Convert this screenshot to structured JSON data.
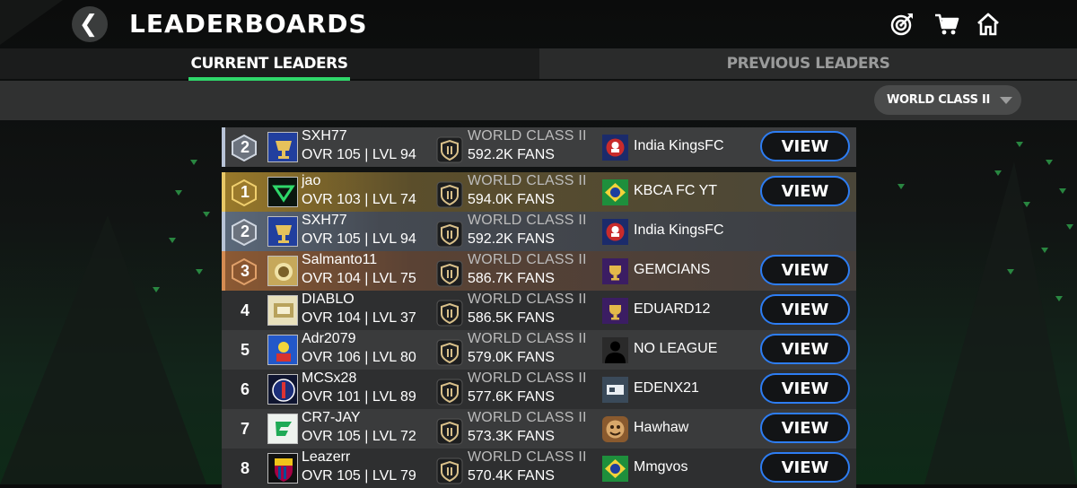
{
  "header": {
    "title": "LEADERBOARDS",
    "back_glyph": "❮",
    "icons": [
      "objectives-icon",
      "store-cart-icon",
      "home-icon"
    ]
  },
  "tabs": [
    {
      "label": "CURRENT LEADERS",
      "active": true
    },
    {
      "label": "PREVIOUS LEADERS",
      "active": false
    }
  ],
  "filter": {
    "selected": "WORLD CLASS II"
  },
  "view_label": "VIEW",
  "colors": {
    "accent_green": "#2fd86a",
    "view_border": "#2d7df3",
    "gold": "#c9a24a",
    "silver": "#9aa6b8",
    "bronze": "#b0744a"
  },
  "my_entry": {
    "rank": "2",
    "name": "SXH77",
    "stats": "OVR 105 | LVL 94",
    "division": "WORLD CLASS II",
    "fans": "592.2K FANS",
    "league": "India KingsFC",
    "has_view": true
  },
  "rows": [
    {
      "rank": "1",
      "name": "jao",
      "stats": "OVR 103 | LVL 74",
      "division": "WORLD CLASS II",
      "fans": "594.0K FANS",
      "league": "KBCA FC YT",
      "has_view": true
    },
    {
      "rank": "2",
      "name": "SXH77",
      "stats": "OVR 105 | LVL 94",
      "division": "WORLD CLASS II",
      "fans": "592.2K FANS",
      "league": "India KingsFC",
      "has_view": false
    },
    {
      "rank": "3",
      "name": "Salmanto11",
      "stats": "OVR 104 | LVL 75",
      "division": "WORLD CLASS II",
      "fans": "586.7K FANS",
      "league": "GEMCIANS",
      "has_view": true
    },
    {
      "rank": "4",
      "name": "DIABLO",
      "stats": "OVR 104 | LVL 37",
      "division": "WORLD CLASS II",
      "fans": "586.5K FANS",
      "league": "EDUARD12",
      "has_view": true
    },
    {
      "rank": "5",
      "name": "Adr2079",
      "stats": "OVR 106 | LVL 80",
      "division": "WORLD CLASS II",
      "fans": "579.0K FANS",
      "league": "NO LEAGUE",
      "has_view": true
    },
    {
      "rank": "6",
      "name": "MCSx28",
      "stats": "OVR 101 | LVL 89",
      "division": "WORLD CLASS II",
      "fans": "577.6K FANS",
      "league": "EDENX21",
      "has_view": true
    },
    {
      "rank": "7",
      "name": "CR7-JAY",
      "stats": "OVR 105 | LVL 72",
      "division": "WORLD CLASS II",
      "fans": "573.3K FANS",
      "league": "Hawhaw",
      "has_view": true
    },
    {
      "rank": "8",
      "name": "Leazerr",
      "stats": "OVR 105 | LVL 79",
      "division": "WORLD CLASS II",
      "fans": "570.4K FANS",
      "league": "Mmgvos",
      "has_view": true
    }
  ]
}
